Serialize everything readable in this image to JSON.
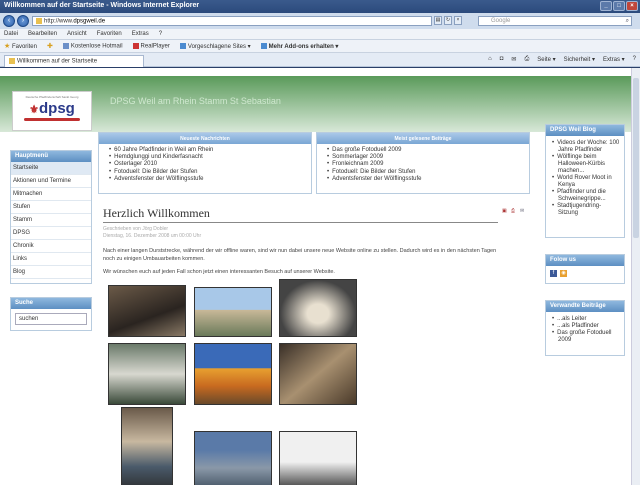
{
  "window": {
    "title": "Willkommen auf der Startseite - Windows Internet Explorer"
  },
  "address": {
    "url_prefix": "http://www.",
    "url_host": "dpsgweil.de",
    "search_placeholder": "Google"
  },
  "menu": [
    "Datei",
    "Bearbeiten",
    "Ansicht",
    "Favoriten",
    "Extras",
    "?"
  ],
  "favorites": {
    "label": "Favoriten",
    "items": [
      "Kostenlose Hotmail",
      "RealPlayer",
      "Vorgeschlagene Sites ▾",
      "Mehr Add-ons erhalten ▾"
    ]
  },
  "tab": {
    "label": "Willkommen auf der Startseite"
  },
  "commands": [
    "Seite ▾",
    "Sicherheit ▾",
    "Extras ▾",
    "?"
  ],
  "header": {
    "title": "DPSG Weil am Rhein Stamm St Sebastian",
    "logo_sub": "Deutsche Pfadfinderschaft Sankt Georg",
    "logo_text": "dpsg"
  },
  "sidebar": {
    "menu_title": "Hauptmenü",
    "items": [
      "Startseite",
      "Aktionen und Termine",
      "Mitmachen",
      "Stufen",
      "Stamm",
      "DPSG",
      "Chronik",
      "Links",
      "Blog"
    ],
    "search_title": "Suche",
    "search_value": "suchen"
  },
  "news": {
    "title": "Neueste Nachrichten",
    "items": [
      "60 Jahre Pfadfinder in Weil am Rhein",
      "Hemdglunggi und Kinderfasnacht",
      "Osterlager 2010",
      "Fotoduell: Die Bilder der Stufen",
      "Adventsfenster der Wölflingsstufe"
    ]
  },
  "popular": {
    "title": "Meist gelesene Beiträge",
    "items": [
      "Das große Fotoduell 2009",
      "Sommerlager 2009",
      "Fronleichnam 2009",
      "Fotoduell: Die Bilder der Stufen",
      "Adventsfenster der Wölflingsstufe"
    ]
  },
  "article": {
    "title": "Herzlich Willkommen",
    "author": "Geschrieben von Jörg Dobler",
    "date": "Dienstag, 16. Dezember 2008 um 00:00 Uhr",
    "para1": "Nach einer langen Durststrecke, während der wir offline waren, sind wir nun dabei unsere neue Website online zu stellen. Dadurch wird es in den nächsten Tagen noch zu einigen Umbauarbeiten kommen.",
    "para2": "Wir wünschen euch auf jeden Fall schon jetzt einen interessanten Besuch auf unserer Website."
  },
  "blog": {
    "title": "DPSG Weil Blog",
    "items": [
      "Videos der Woche: 100 Jahre Pfadfinder",
      "Wölflinge beim Halloween-Kürbis machen...",
      "World Rover Moot in Kenya",
      "Pfadfinder und die Schweinegrippe...",
      "Stadtjugendring-Sitzung"
    ]
  },
  "follow": {
    "title": "Folow us"
  },
  "related": {
    "title": "Verwandte Beiträge",
    "items": [
      "...als Leiter",
      "...als Pfadfinder",
      "Das große Fotoduell 2009"
    ]
  },
  "colors": {
    "brand_blue": "#2b3a8a",
    "brand_red": "#c03030",
    "header_green": "#5a9a5a",
    "box_blue": "#5d8fc2"
  }
}
